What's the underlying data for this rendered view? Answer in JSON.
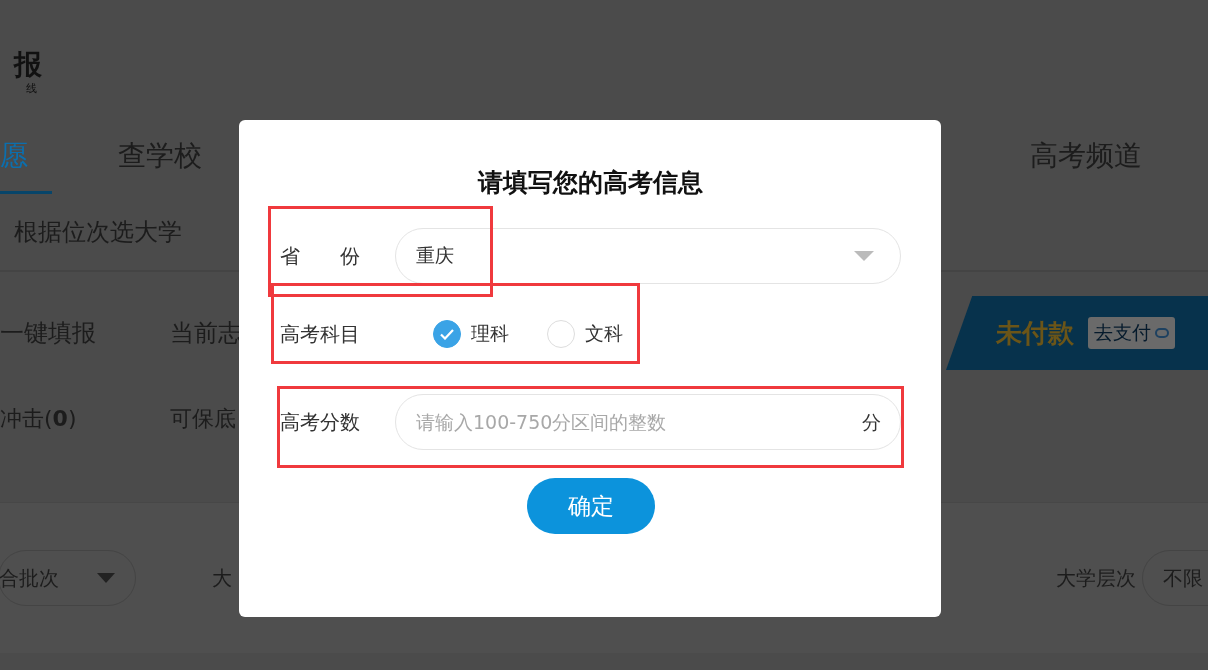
{
  "logo": {
    "title": "报",
    "subtitle": "线"
  },
  "nav": [
    {
      "label": "愿",
      "selected": true
    },
    {
      "label": "查学校",
      "selected": false
    },
    {
      "label": "高考频道",
      "selected": false
    }
  ],
  "subnav": {
    "label": "根据位次选大学"
  },
  "summary": {
    "items": [
      "一键填报",
      "当前志"
    ],
    "counts": [
      "冲击(**0**)",
      "可保底"
    ]
  },
  "payment_banner": {
    "status": "未付款",
    "button": "去支付"
  },
  "filters": {
    "batch": "合批次",
    "label_1": "大",
    "label_2": "大学层次",
    "level": "不限"
  },
  "dialog": {
    "title": "请填写您的高考信息",
    "province": {
      "label": "省　　份",
      "value": "重庆",
      "highlighted": true
    },
    "subject": {
      "label": "高考科目",
      "options": [
        {
          "label": "理科",
          "selected": true
        },
        {
          "label": "文科",
          "selected": false
        }
      ],
      "highlighted": true
    },
    "score": {
      "label": "高考分数",
      "placeholder": "请输入100-750分区间的整数",
      "unit": "分",
      "highlighted": true
    },
    "confirm": "确定"
  }
}
